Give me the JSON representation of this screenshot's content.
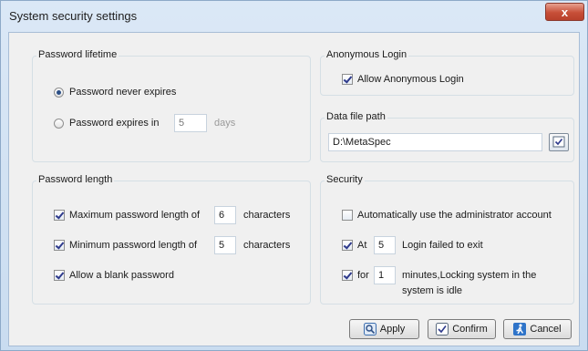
{
  "window": {
    "title": "System security settings",
    "close_label": "x"
  },
  "password_lifetime": {
    "title": "Password lifetime",
    "never_expires_label": "Password never expires",
    "expires_in_label": "Password expires in",
    "expires_days_value": "5",
    "days_label": "days",
    "selected": "never"
  },
  "anonymous_login": {
    "title": "Anonymous Login",
    "allow_label": "Allow Anonymous Login",
    "allow_checked": true
  },
  "data_file_path": {
    "title": "Data file path",
    "value": "D:\\MetaSpec"
  },
  "password_length": {
    "title": "Password length",
    "max_label": "Maximum password length of",
    "max_value": "6",
    "max_unit": "characters",
    "min_label": "Minimum password length of",
    "min_value": "5",
    "min_unit": "characters",
    "blank_label": "Allow a blank password",
    "max_checked": true,
    "min_checked": true,
    "blank_checked": true
  },
  "security": {
    "title": "Security",
    "admin_label": "Automatically use the administrator account",
    "admin_checked": false,
    "at_label": "At",
    "at_value": "5",
    "login_failed_label": "Login failed to exit",
    "for_label": "for",
    "for_value": "1",
    "lock_label_line1": "minutes,Locking system in the",
    "lock_label_line2": "system is idle",
    "at_checked": true,
    "for_checked": true
  },
  "buttons": {
    "apply": "Apply",
    "confirm": "Confirm",
    "cancel": "Cancel"
  }
}
